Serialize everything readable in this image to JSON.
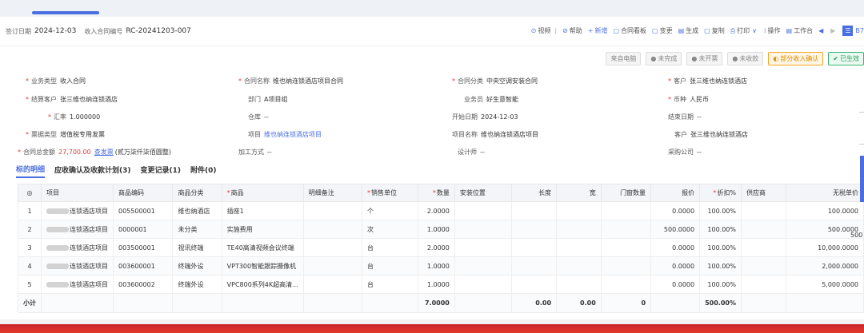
{
  "header": {
    "sign_date_label": "签订日期",
    "sign_date": "2024-12-03",
    "contract_no_label": "收入合同编号",
    "contract_no": "RC-20241203-007"
  },
  "toolbar": {
    "items": [
      {
        "icon": "video-icon",
        "label": "视频"
      },
      {
        "icon": "help-icon",
        "label": "帮助"
      },
      {
        "icon": "plus-icon",
        "label": "新增"
      },
      {
        "icon": "board-icon",
        "label": "合同看板"
      },
      {
        "icon": "change-icon",
        "label": "变更"
      },
      {
        "icon": "generate-icon",
        "label": "生成"
      },
      {
        "icon": "copy-icon",
        "label": "复制"
      },
      {
        "icon": "print-icon",
        "label": "打印"
      },
      {
        "icon": "operate-icon",
        "label": "操作"
      },
      {
        "icon": "workbench-icon",
        "label": "工作台"
      }
    ],
    "tail_label": "B7"
  },
  "status": [
    {
      "label": "来自电脑",
      "style": "plain"
    },
    {
      "label": "未完成",
      "style": "plain"
    },
    {
      "label": "未开票",
      "style": "plain"
    },
    {
      "label": "未收款",
      "style": "plain"
    },
    {
      "label": "部分收入确认",
      "style": "orange"
    },
    {
      "label": "已生效",
      "style": "green"
    }
  ],
  "form": {
    "business_type_label": "业务类型",
    "business_type": "收入合同",
    "contract_name_label": "合同名称",
    "contract_name": "维也纳连锁酒店项目合同",
    "contract_category_label": "合同分类",
    "contract_category": "中央空调安装合同",
    "customer_label": "客户",
    "customer": "张三维也纳连锁酒店",
    "settle_customer_label": "结算客户",
    "settle_customer": "张三维也纳连锁酒店",
    "dept_label": "部门",
    "dept": "A项目组",
    "salesman_label": "业务员",
    "salesman": "好生意智能",
    "currency_label": "币种",
    "currency": "人民币",
    "rate_label": "汇率",
    "rate": "1.000000",
    "warehouse_label": "仓库",
    "warehouse": "--",
    "start_date_label": "开始日期",
    "start_date": "2024-12-03",
    "end_date_label": "结束日期",
    "end_date": "--",
    "invoice_type_label": "票据类型",
    "invoice_type": "增值税专用发票",
    "project_label": "项目",
    "project": "维也纳连锁酒店项目",
    "project_name_label": "项目名称",
    "project_name": "维也纳连锁酒店项目",
    "customer2_label": "客户",
    "customer2": "张三维也纳连锁酒店",
    "total_label": "合同总金额",
    "total": "27,700.00",
    "total_link": "查发票",
    "total_note": "(贰万柒仟柒佰圆整)",
    "process_label": "加工方式",
    "process": "--",
    "designer_label": "设计师",
    "designer": "--",
    "purchase_label": "采购公司",
    "purchase": "--"
  },
  "tabs": [
    "标的明细",
    "应收确认及收款计划(3)",
    "变更记录(1)",
    "附件(0)"
  ],
  "table": {
    "columns": [
      "项目",
      "商品编码",
      "商品分类",
      "商品",
      "明细备注",
      "销售单位",
      "数量",
      "安装位置",
      "长度",
      "宽",
      "门窗数量",
      "报价",
      "折扣%",
      "供应商",
      "无税单价"
    ],
    "rows": [
      {
        "idx": "1",
        "project": "连锁酒店项目",
        "code": "005500001",
        "cat": "维也纳酒店",
        "product": "插座1",
        "remark": "",
        "unit": "个",
        "qty": "2.0000",
        "pos": "",
        "len": "",
        "wid": "",
        "doors": "",
        "quote": "0.0000",
        "disc": "100.00%",
        "supplier": "",
        "price": "100.0000"
      },
      {
        "idx": "2",
        "project": "连锁酒店项目",
        "code": "0000001",
        "cat": "未分类",
        "product": "实施费用",
        "remark": "",
        "unit": "次",
        "qty": "1.0000",
        "pos": "",
        "len": "",
        "wid": "",
        "doors": "",
        "quote": "500.0000",
        "disc": "100.00%",
        "supplier": "",
        "price": "500.0000"
      },
      {
        "idx": "3",
        "project": "连锁酒店项目",
        "code": "003500001",
        "cat": "视讯终端",
        "product": "TE40高清视频会议终端",
        "remark": "",
        "unit": "台",
        "qty": "2.0000",
        "pos": "",
        "len": "",
        "wid": "",
        "doors": "",
        "quote": "0.0000",
        "disc": "100.00%",
        "supplier": "",
        "price": "10,000.0000"
      },
      {
        "idx": "4",
        "project": "连锁酒店项目",
        "code": "003600001",
        "cat": "终端外设",
        "product": "VPT300智能跟踪摄像机",
        "remark": "",
        "unit": "台",
        "qty": "1.0000",
        "pos": "",
        "len": "",
        "wid": "",
        "doors": "",
        "quote": "0.0000",
        "disc": "100.00%",
        "supplier": "",
        "price": "2,000.0000"
      },
      {
        "idx": "5",
        "project": "连锁酒店项目",
        "code": "003600002",
        "cat": "终端外设",
        "product": "VPC800系列4K超高清...",
        "remark": "",
        "unit": "台",
        "qty": "1.0000",
        "pos": "",
        "len": "",
        "wid": "",
        "doors": "",
        "quote": "0.0000",
        "disc": "100.00%",
        "supplier": "",
        "price": "5,000.0000"
      }
    ],
    "subtotal": {
      "label": "小计",
      "qty": "7.0000",
      "len": "0.00",
      "wid": "0.00",
      "doors": "0",
      "disc": "500.00%"
    },
    "overflow_value": "500"
  }
}
